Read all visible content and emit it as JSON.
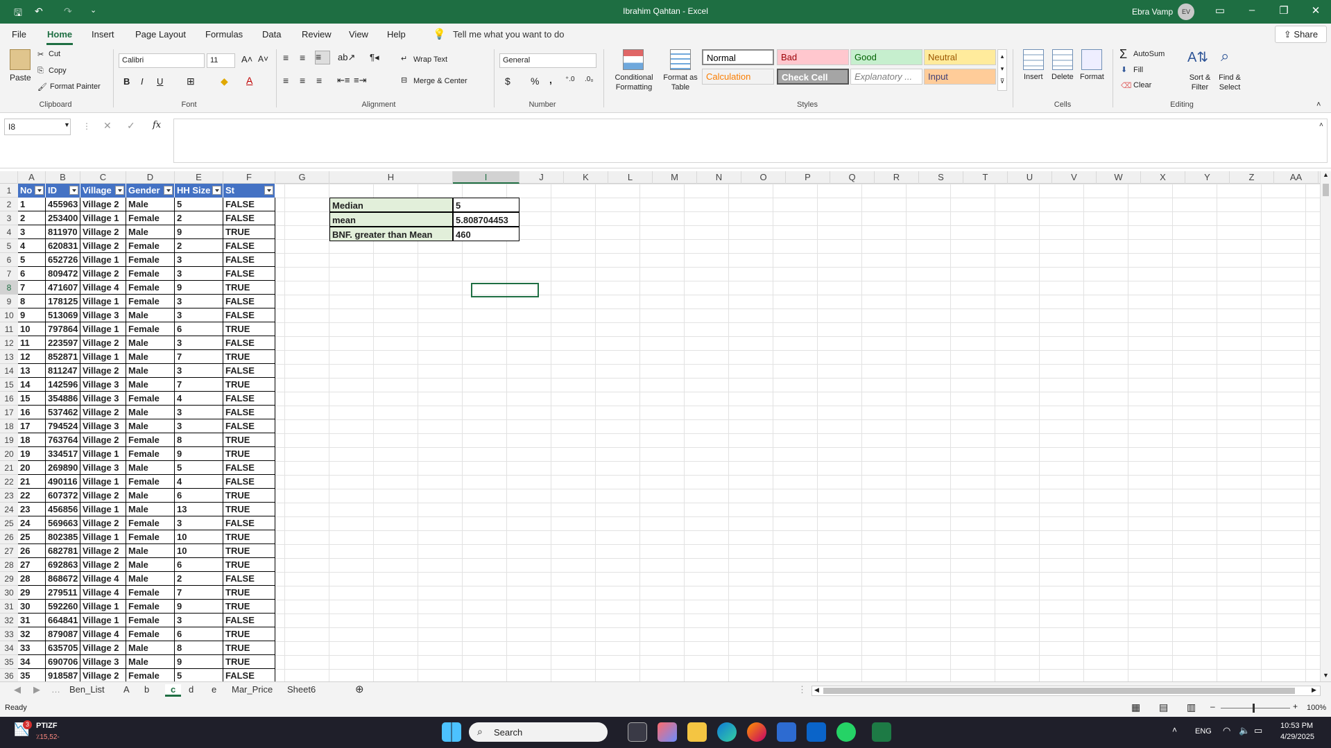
{
  "titlebar": {
    "title": "Ibrahim Qahtan  -  Excel",
    "user": "Ebra Vamp",
    "avatar": "EV"
  },
  "menu": {
    "tabs": [
      "File",
      "Home",
      "Insert",
      "Page Layout",
      "Formulas",
      "Data",
      "Review",
      "View",
      "Help"
    ],
    "tell_me": "Tell me what you want to do",
    "share": "Share"
  },
  "ribbon": {
    "clipboard": {
      "paste": "Paste",
      "cut": "Cut",
      "copy": "Copy",
      "format_painter": "Format Painter",
      "group": "Clipboard"
    },
    "font": {
      "name": "Calibri",
      "size": "11",
      "group": "Font",
      "bold": "B",
      "italic": "I",
      "underline": "U"
    },
    "alignment": {
      "wrap": "Wrap Text",
      "merge": "Merge & Center",
      "group": "Alignment"
    },
    "number": {
      "format": "General",
      "group": "Number",
      "currency": "$",
      "percent": "%",
      "comma": ","
    },
    "styles": {
      "conditional": "Conditional Formatting",
      "format_as_table": "Format as Table",
      "group": "Styles",
      "cells": [
        {
          "label": "Normal",
          "bg": "#ffffff",
          "fg": "#000000"
        },
        {
          "label": "Bad",
          "bg": "#ffc7ce",
          "fg": "#9c0006"
        },
        {
          "label": "Good",
          "bg": "#c6efce",
          "fg": "#006100"
        },
        {
          "label": "Neutral",
          "bg": "#ffeb9c",
          "fg": "#9c5700"
        },
        {
          "label": "Calculation",
          "bg": "#f2f2f2",
          "fg": "#fa7d00"
        },
        {
          "label": "Check Cell",
          "bg": "#a5a5a5",
          "fg": "#ffffff"
        },
        {
          "label": "Explanatory ...",
          "bg": "#ffffff",
          "fg": "#7f7f7f"
        },
        {
          "label": "Input",
          "bg": "#ffcc99",
          "fg": "#3f3f76"
        }
      ]
    },
    "cells": {
      "insert": "Insert",
      "delete": "Delete",
      "format": "Format",
      "group": "Cells"
    },
    "editing": {
      "autosum": "AutoSum",
      "fill": "Fill",
      "clear": "Clear",
      "sort": "Sort & Filter",
      "find": "Find & Select",
      "group": "Editing"
    }
  },
  "formula_bar": {
    "name_box": "I8",
    "fx": "fx",
    "content": ""
  },
  "columns": [
    "A",
    "B",
    "C",
    "D",
    "E",
    "F",
    "G",
    "H",
    "I",
    "J",
    "K",
    "L",
    "M",
    "N",
    "O",
    "P",
    "Q",
    "R",
    "S",
    "T",
    "U",
    "V",
    "W",
    "X",
    "Y",
    "Z",
    "AA"
  ],
  "table": {
    "headers": [
      "No",
      "ID",
      "Village",
      "Gender",
      "HH Size",
      "St"
    ],
    "rows": [
      [
        "1",
        "455963",
        "Village 2",
        "Male",
        "5",
        "FALSE"
      ],
      [
        "2",
        "253400",
        "Village 1",
        "Female",
        "2",
        "FALSE"
      ],
      [
        "3",
        "811970",
        "Village 2",
        "Male",
        "9",
        "TRUE"
      ],
      [
        "4",
        "620831",
        "Village 2",
        "Female",
        "2",
        "FALSE"
      ],
      [
        "5",
        "652726",
        "Village 1",
        "Female",
        "3",
        "FALSE"
      ],
      [
        "6",
        "809472",
        "Village 2",
        "Female",
        "3",
        "FALSE"
      ],
      [
        "7",
        "471607",
        "Village 4",
        "Female",
        "9",
        "TRUE"
      ],
      [
        "8",
        "178125",
        "Village 1",
        "Female",
        "3",
        "FALSE"
      ],
      [
        "9",
        "513069",
        "Village 3",
        "Male",
        "3",
        "FALSE"
      ],
      [
        "10",
        "797864",
        "Village 1",
        "Female",
        "6",
        "TRUE"
      ],
      [
        "11",
        "223597",
        "Village 2",
        "Male",
        "3",
        "FALSE"
      ],
      [
        "12",
        "852871",
        "Village 1",
        "Male",
        "7",
        "TRUE"
      ],
      [
        "13",
        "811247",
        "Village 2",
        "Male",
        "3",
        "FALSE"
      ],
      [
        "14",
        "142596",
        "Village 3",
        "Male",
        "7",
        "TRUE"
      ],
      [
        "15",
        "354886",
        "Village 3",
        "Female",
        "4",
        "FALSE"
      ],
      [
        "16",
        "537462",
        "Village 2",
        "Male",
        "3",
        "FALSE"
      ],
      [
        "17",
        "794524",
        "Village 3",
        "Male",
        "3",
        "FALSE"
      ],
      [
        "18",
        "763764",
        "Village 2",
        "Female",
        "8",
        "TRUE"
      ],
      [
        "19",
        "334517",
        "Village 1",
        "Female",
        "9",
        "TRUE"
      ],
      [
        "20",
        "269890",
        "Village 3",
        "Male",
        "5",
        "FALSE"
      ],
      [
        "21",
        "490116",
        "Village 1",
        "Female",
        "4",
        "FALSE"
      ],
      [
        "22",
        "607372",
        "Village 2",
        "Male",
        "6",
        "TRUE"
      ],
      [
        "23",
        "456856",
        "Village 1",
        "Male",
        "13",
        "TRUE"
      ],
      [
        "24",
        "569663",
        "Village 2",
        "Female",
        "3",
        "FALSE"
      ],
      [
        "25",
        "802385",
        "Village 1",
        "Female",
        "10",
        "TRUE"
      ],
      [
        "26",
        "682781",
        "Village 2",
        "Male",
        "10",
        "TRUE"
      ],
      [
        "27",
        "692863",
        "Village 2",
        "Male",
        "6",
        "TRUE"
      ],
      [
        "28",
        "868672",
        "Village 4",
        "Male",
        "2",
        "FALSE"
      ],
      [
        "29",
        "279511",
        "Village 4",
        "Female",
        "7",
        "TRUE"
      ],
      [
        "30",
        "592260",
        "Village 1",
        "Female",
        "9",
        "TRUE"
      ],
      [
        "31",
        "664841",
        "Village 1",
        "Female",
        "3",
        "FALSE"
      ],
      [
        "32",
        "879087",
        "Village 4",
        "Female",
        "6",
        "TRUE"
      ],
      [
        "33",
        "635705",
        "Village 2",
        "Male",
        "8",
        "TRUE"
      ],
      [
        "34",
        "690706",
        "Village 3",
        "Male",
        "9",
        "TRUE"
      ],
      [
        "35",
        "918587",
        "Village 2",
        "Female",
        "5",
        "FALSE"
      ]
    ]
  },
  "summary": [
    {
      "label": "Median",
      "value": "5"
    },
    {
      "label": "mean",
      "value": "5.808704453"
    },
    {
      "label": "BNF. greater than Mean",
      "value": "460"
    }
  ],
  "sheets": [
    "Ben_List",
    "A",
    "b",
    "c",
    "d",
    "e",
    "Mar_Price",
    "Sheet6"
  ],
  "active_sheet": "c",
  "status": {
    "ready": "Ready",
    "zoom": "100%"
  },
  "taskbar": {
    "notif_count": "3",
    "notif_title": "PTIZF",
    "notif_sub": "٪15,52-",
    "search": "Search",
    "lang": "ENG",
    "time": "10:53 PM",
    "date": "4/29/2025"
  }
}
